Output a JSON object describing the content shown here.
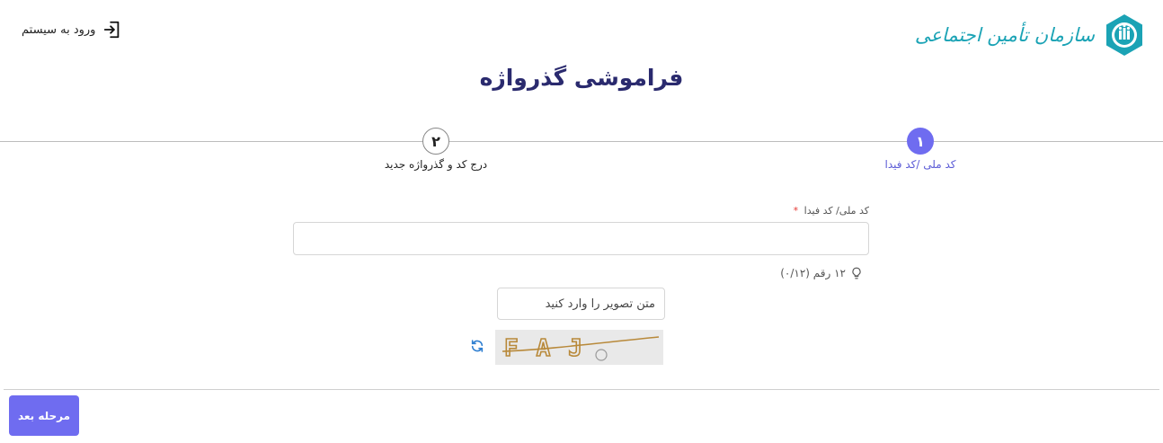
{
  "header": {
    "logo_text": "سازمان تأمین اجتماعی",
    "login_label": "ورود به سیستم"
  },
  "page": {
    "title": "فراموشی گذرواژه"
  },
  "steps": [
    {
      "number": "۱",
      "label": "کد ملی /کد فیدا"
    },
    {
      "number": "۲",
      "label": "درج کد و گذرواژه جدید"
    }
  ],
  "form": {
    "national_code_label": "کد ملی/ کد فیدا",
    "required_mark": "*",
    "national_code_value": "",
    "hint_text": "۱۲ رقم (۰/۱۲)",
    "captcha_placeholder": "متن تصویر را وارد کنید",
    "captcha_text": "FAJ"
  },
  "footer": {
    "next_label": "مرحله بعد"
  },
  "colors": {
    "primary": "#6f6cf0",
    "title": "#2a2a6e",
    "brand": "#1ba3b5",
    "captcha_ink": "#b8893a"
  }
}
